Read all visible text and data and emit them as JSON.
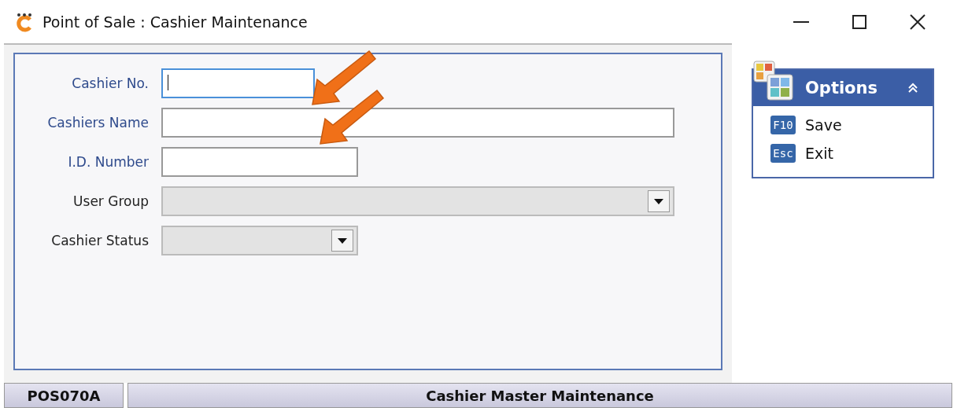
{
  "window": {
    "title": "Point of Sale : Cashier Maintenance"
  },
  "form": {
    "fields": [
      {
        "label": "Cashier No.",
        "kind": "text",
        "required": true,
        "focused": true,
        "pointer": true
      },
      {
        "label": "Cashiers Name",
        "kind": "text",
        "required": true,
        "focused": false,
        "pointer": true
      },
      {
        "label": "I.D. Number",
        "kind": "text",
        "required": true,
        "focused": false
      },
      {
        "label": "User Group",
        "kind": "dropdown",
        "required": false
      },
      {
        "label": "Cashier Status",
        "kind": "dropdown",
        "required": false
      }
    ]
  },
  "options": {
    "title": "Options",
    "expanded": true,
    "items": [
      {
        "key": "F10",
        "label": "Save"
      },
      {
        "key": "Esc",
        "label": "Exit"
      }
    ]
  },
  "status_bar": {
    "code": "POS070A",
    "title": "Cashier Master Maintenance"
  }
}
